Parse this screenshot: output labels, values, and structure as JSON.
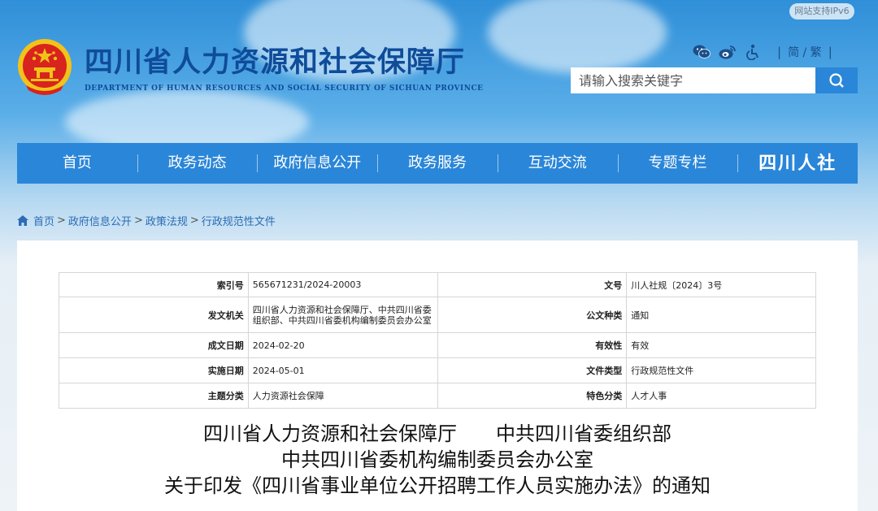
{
  "header": {
    "ipv6": "网站支持IPv6",
    "title": "四川省人力资源和社会保障厅",
    "subtitle": "DEPARTMENT OF HUMAN RESOURCES AND SOCIAL SECURITY OF SICHUAN PROVINCE",
    "lang": "简 / 繁",
    "search_placeholder": "请输入搜索关键字"
  },
  "nav": {
    "items": [
      "首页",
      "政务动态",
      "政府信息公开",
      "政务服务",
      "互动交流",
      "专题专栏"
    ],
    "logo_text": "四川人社"
  },
  "breadcrumb": [
    "首页",
    "政府信息公开",
    "政策法规",
    "行政规范性文件"
  ],
  "meta": {
    "index_label": "索引号",
    "index_value": "565671231/2024-20003",
    "docno_label": "文号",
    "docno_value": "川人社规〔2024〕3号",
    "issuer_label": "发文机关",
    "issuer_value": "四川省人力资源和社会保障厅、中共四川省委组织部、中共四川省委机构编制委员会办公室",
    "category_label": "公文种类",
    "category_value": "通知",
    "date_label": "成文日期",
    "date_value": "2024-02-20",
    "validity_label": "有效性",
    "validity_value": "有效",
    "impl_label": "实施日期",
    "impl_value": "2024-05-01",
    "filetype_label": "文件类型",
    "filetype_value": "行政规范性文件",
    "topic_label": "主题分类",
    "topic_value": "人力资源社会保障",
    "feature_label": "特色分类",
    "feature_value": "人才人事"
  },
  "doc_title": {
    "line1": "四川省人力资源和社会保障厅　　中共四川省委组织部",
    "line2": "中共四川省委机构编制委员会办公室",
    "line3": "关于印发《四川省事业单位公开招聘工作人员实施办法》的通知"
  },
  "colors": {
    "brand_blue": "#2a86d8",
    "title_blue": "#0f4c9a",
    "emblem_red": "#d8231e",
    "emblem_gold": "#f2c21a"
  },
  "icons": [
    "wechat-icon",
    "weibo-icon",
    "accessibility-icon",
    "search-icon",
    "home-icon"
  ]
}
